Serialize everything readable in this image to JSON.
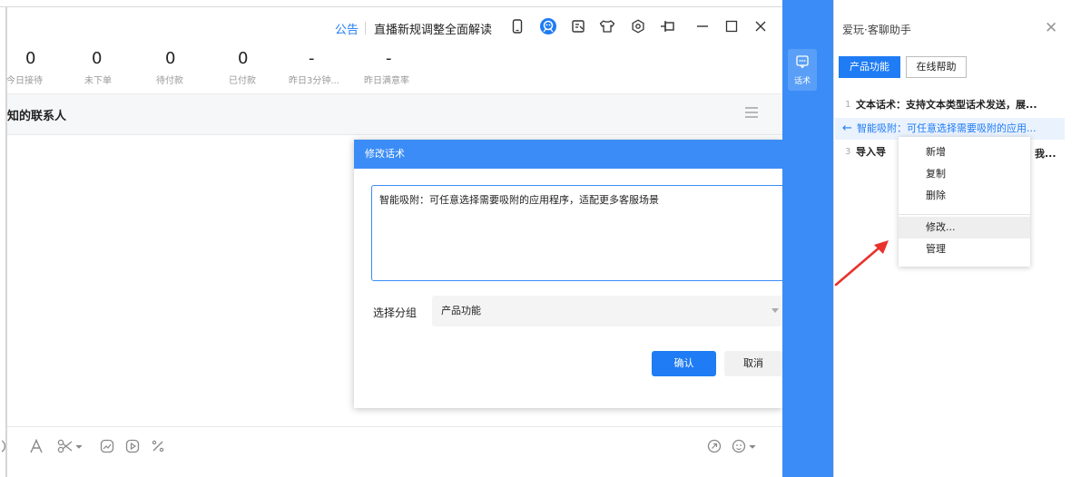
{
  "titlebar": {
    "announcement_label": "公告",
    "announcement_text": "直播新规调整全面解读"
  },
  "stats": [
    {
      "value": "0",
      "label": "今日接待"
    },
    {
      "value": "0",
      "label": "未下单"
    },
    {
      "value": "0",
      "label": "待付款"
    },
    {
      "value": "0",
      "label": "已付款"
    },
    {
      "value": "-",
      "label": "昨日3分钟..."
    },
    {
      "value": "-",
      "label": "昨日满意率"
    }
  ],
  "contact": {
    "title": "知的联系人"
  },
  "modal": {
    "title": "修改话术",
    "text": "智能吸附：可任意选择需要吸附的应用程序，适配更多客服场景",
    "group_label": "选择分组",
    "group_value": "产品功能",
    "confirm_label": "确认",
    "cancel_label": "取消"
  },
  "bluebar": {
    "script_tab_label": "话术"
  },
  "panel": {
    "title": "爱玩·客聊助手",
    "tabs": [
      {
        "label": "产品功能",
        "active": true
      },
      {
        "label": "在线帮助",
        "active": false
      }
    ],
    "scripts": [
      {
        "num": "1",
        "text": "文本话术：支持文本类型话术发送，展..."
      },
      {
        "num": "",
        "text": "智能吸附：可任意选择需要吸附的应用..."
      },
      {
        "num": "3",
        "text": "导入导"
      }
    ],
    "row3_suffix": "我..."
  },
  "context_menu": {
    "items": [
      "新增",
      "复制",
      "删除",
      "修改...",
      "管理"
    ]
  },
  "colors": {
    "accent": "#1f7cf4",
    "bar_blue": "#3b8cf6",
    "annotation_red": "#e8322b"
  }
}
